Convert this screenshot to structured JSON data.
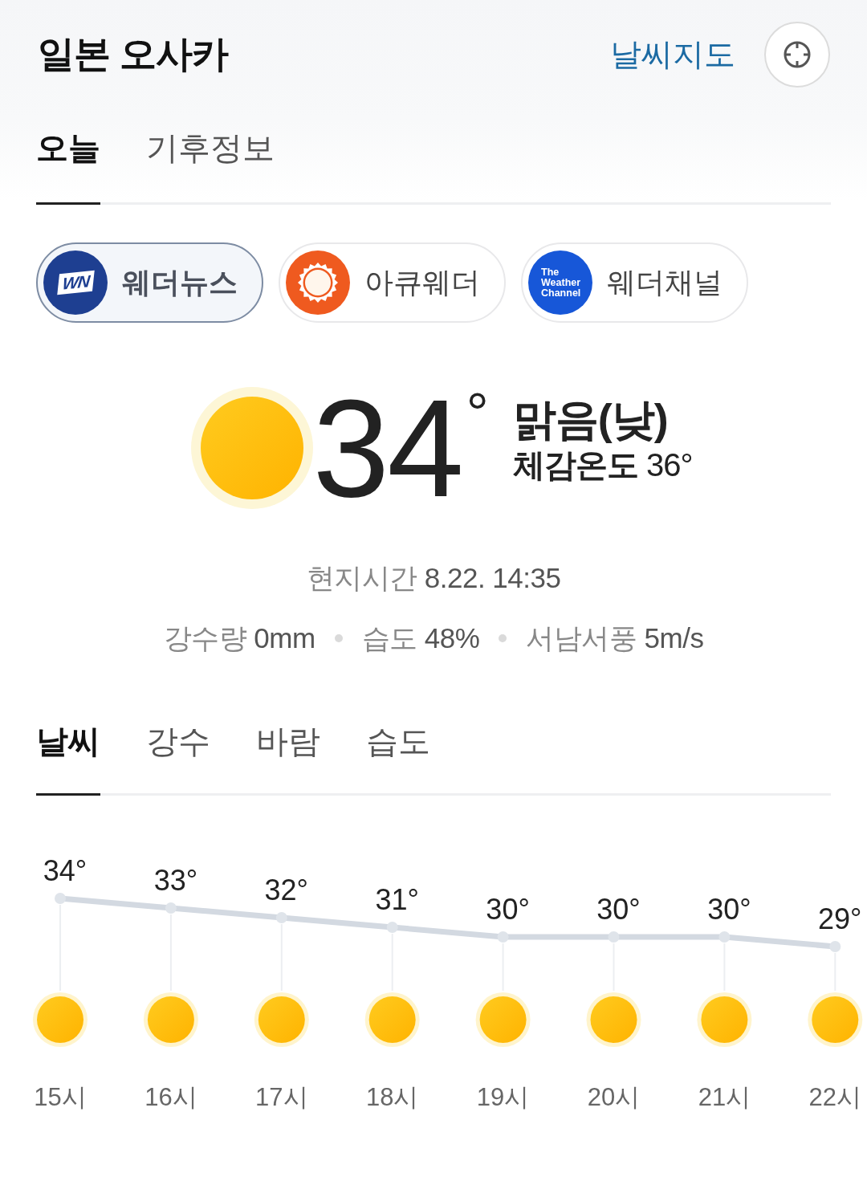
{
  "header": {
    "title": "일본 오사카",
    "map_link": "날씨지도"
  },
  "tabs": [
    {
      "label": "오늘",
      "selected": true
    },
    {
      "label": "기후정보",
      "selected": false
    }
  ],
  "sources": [
    {
      "kind": "wn",
      "name": "웨더뉴스",
      "logo_text": [
        "WN"
      ],
      "selected": true
    },
    {
      "kind": "sun",
      "name": "아큐웨더",
      "selected": false
    },
    {
      "kind": "twc",
      "name": "웨더채널",
      "logo_text": [
        "The",
        "Weather",
        "Channel"
      ],
      "selected": false
    }
  ],
  "current": {
    "weather_icon": {
      "kind": "sun"
    },
    "temperature": "34",
    "unit": "°",
    "condition": "맑음(낮)",
    "feels_like": "**체감온도** 36°",
    "local_time": {
      "label": "현지시간",
      "value": "8.22. 14:35"
    },
    "stats": [
      {
        "label": "강수량",
        "value": "0mm"
      },
      {
        "label": "습도",
        "value": "48%"
      },
      {
        "label": "서남서풍",
        "value": "5m/s"
      }
    ]
  },
  "hourly": {
    "tabs": [
      {
        "label": "날씨",
        "selected": true
      },
      {
        "label": "강수",
        "selected": false
      },
      {
        "label": "바람",
        "selected": false
      },
      {
        "label": "습도",
        "selected": false
      }
    ],
    "weather_icons": [
      {
        "kind": "sun"
      },
      {
        "kind": "sun"
      },
      {
        "kind": "sun"
      },
      {
        "kind": "sun"
      },
      {
        "kind": "sun"
      },
      {
        "kind": "sun"
      },
      {
        "kind": "sun"
      },
      {
        "kind": "sun"
      }
    ],
    "chart_data": {
      "type": "line",
      "categories": [
        "15시",
        "16시",
        "17시",
        "18시",
        "19시",
        "20시",
        "21시",
        "22시"
      ],
      "values": [
        34,
        33,
        32,
        31,
        30,
        30,
        30,
        29
      ],
      "value_labels": [
        "34°",
        "33°",
        "32°",
        "31°",
        "30°",
        "30°",
        "30°",
        "29°"
      ],
      "grid": true,
      "marker": true
    }
  }
}
